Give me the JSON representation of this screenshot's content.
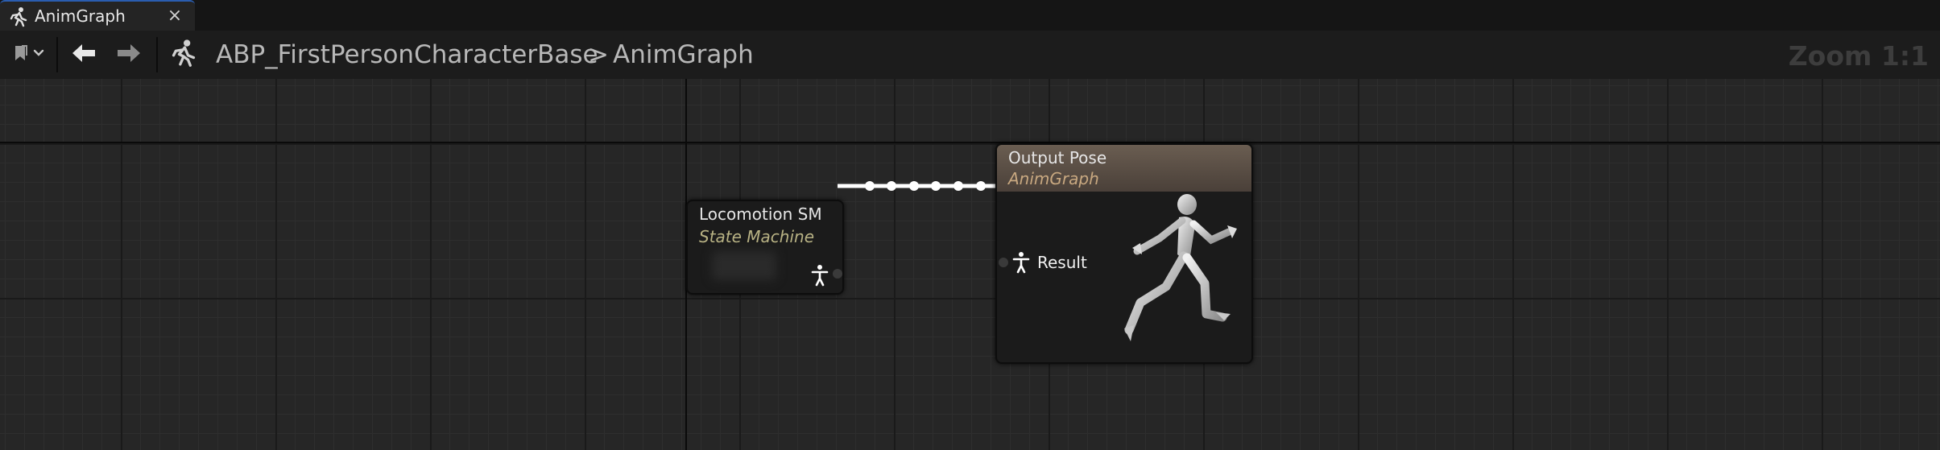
{
  "tab": {
    "label": "AnimGraph",
    "icon": "running-figure-icon",
    "close": "×"
  },
  "toolbar": {
    "bookmark_icon": "bookmark-icon",
    "back_icon": "arrow-left-icon",
    "forward_icon": "arrow-right-icon",
    "asset_icon": "running-figure-icon",
    "breadcrumb": {
      "asset": "ABP_FirstPersonCharacterBase",
      "separator": ">",
      "graph": "AnimGraph"
    },
    "zoom": "Zoom 1:1"
  },
  "nodes": {
    "state_machine": {
      "title": "Locomotion SM",
      "subtitle": "State Machine",
      "subtitle_color": "#b8b284"
    },
    "output_pose": {
      "title": "Output Pose",
      "subtitle": "AnimGraph",
      "subtitle_color": "#c8a880",
      "pin_label": "Result"
    }
  },
  "colors": {
    "tab_accent": "#2a5db0",
    "output_header": "#5a4e44",
    "wire": "#ffffff"
  }
}
